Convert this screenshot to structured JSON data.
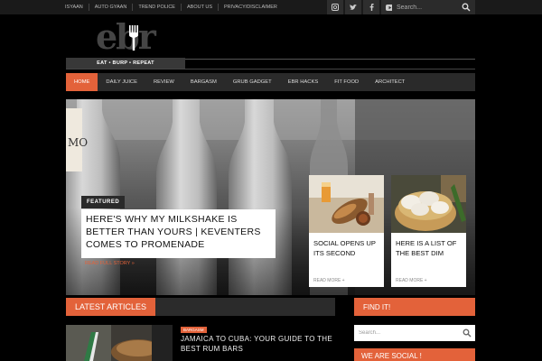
{
  "topbar": {
    "links": [
      "ISYAAN",
      "AUTO GYAAN",
      "TREND POLICE",
      "ABOUT US",
      "PRIVACY/DISCLAIMER"
    ],
    "social": [
      "instagram-icon",
      "twitter-icon",
      "facebook-icon",
      "youtube-icon"
    ],
    "search_placeholder": "Search..."
  },
  "logo": {
    "text": "ebr",
    "tagline": "EAT • BURP • REPEAT"
  },
  "nav": {
    "items": [
      "HOME",
      "DAILY JUICE",
      "REVIEW",
      "BARGASM",
      "GRUB GADGET",
      "EBR HACKS",
      "FIT FOOD",
      "ARCHITECT"
    ],
    "active": "HOME"
  },
  "hero": {
    "tag": "FEATURED",
    "title": "HERE'S WHY MY MILKSHAKE IS BETTER THAN YOURS | KEVENTERS COMES TO PROMENADE",
    "read_more": "READ FULL STORY »"
  },
  "cards": [
    {
      "title": "SOCIAL OPENS UP ITS SECOND",
      "more": "READ MORE +"
    },
    {
      "title": "HERE IS A LIST OF THE BEST DIM",
      "more": "READ MORE +"
    }
  ],
  "latest": {
    "label": "LATEST ARTICLES",
    "article": {
      "category": "BARGASM",
      "title": "Jamaica to Cuba: Your Guide to the Best Rum Bars"
    }
  },
  "sidebar": {
    "find_label": "FIND IT!",
    "search_placeholder": "Search...",
    "social_label": "WE ARE SOCIAL !"
  },
  "colors": {
    "accent": "#e3623a",
    "bg": "#000000",
    "bar": "#2a2a2a"
  }
}
